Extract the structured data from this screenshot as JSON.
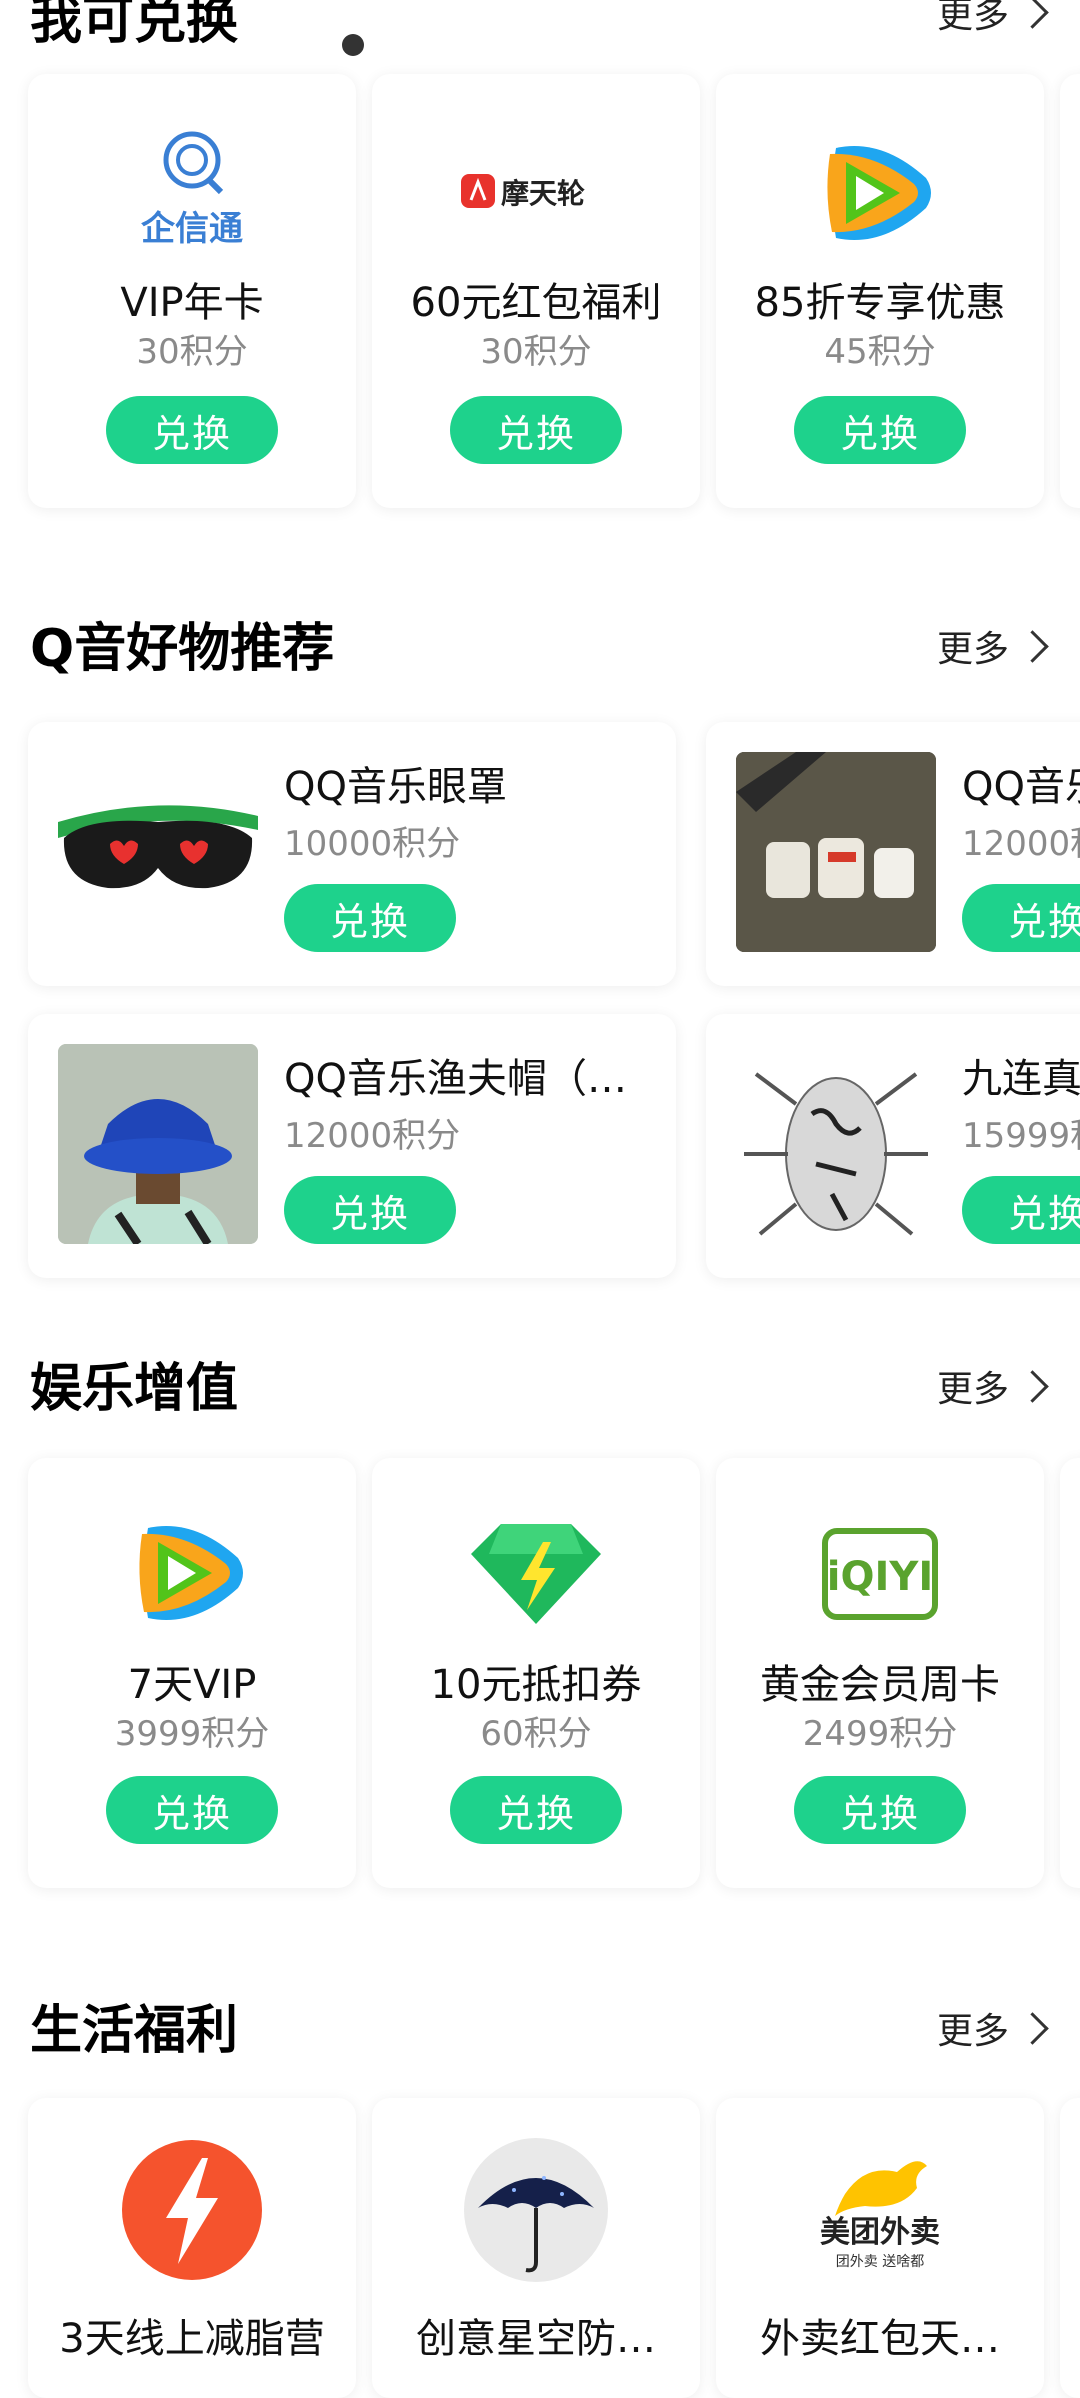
{
  "sections": {
    "exchange": {
      "title": "我可兑换",
      "more": "更多"
    },
    "qq_goods": {
      "title": "Q音好物推荐",
      "more": "更多"
    },
    "entertainment": {
      "title": "娱乐增值",
      "more": "更多"
    },
    "life": {
      "title": "生活福利",
      "more": "更多"
    }
  },
  "exchange_items": [
    {
      "logo": "企信通",
      "name": "VIP年卡",
      "points": "30积分",
      "button": "兑换"
    },
    {
      "logo": "摩天轮",
      "name": "60元红包福利",
      "points": "30积分",
      "button": "兑换"
    },
    {
      "logo": "",
      "name": "85折专享优惠",
      "points": "45积分",
      "button": "兑换"
    }
  ],
  "goods_items": [
    {
      "name": "QQ音乐眼罩",
      "points": "10000积分",
      "button": "兑换"
    },
    {
      "name": "QQ音乐",
      "points": "12000积",
      "button": "兑换"
    },
    {
      "name": "QQ音乐渔夫帽（…",
      "points": "12000积分",
      "button": "兑换"
    },
    {
      "name": "九连真",
      "points": "15999积",
      "button": "兑换"
    }
  ],
  "entertainment_items": [
    {
      "name": "7天VIP",
      "points": "3999积分",
      "button": "兑换"
    },
    {
      "name": "10元抵扣券",
      "points": "60积分",
      "button": "兑换"
    },
    {
      "logo": "iQIYI",
      "name": "黄金会员周卡",
      "points": "2499积分",
      "button": "兑换"
    }
  ],
  "life_items": [
    {
      "name": "3天线上减脂营"
    },
    {
      "name": "创意星空防…"
    },
    {
      "logo": "美团外卖",
      "logo_sub": "团外卖 送啥都",
      "name": "外卖红包天…"
    }
  ],
  "colors": {
    "accent": "#1ed28c",
    "muted": "#8a8a8a"
  }
}
